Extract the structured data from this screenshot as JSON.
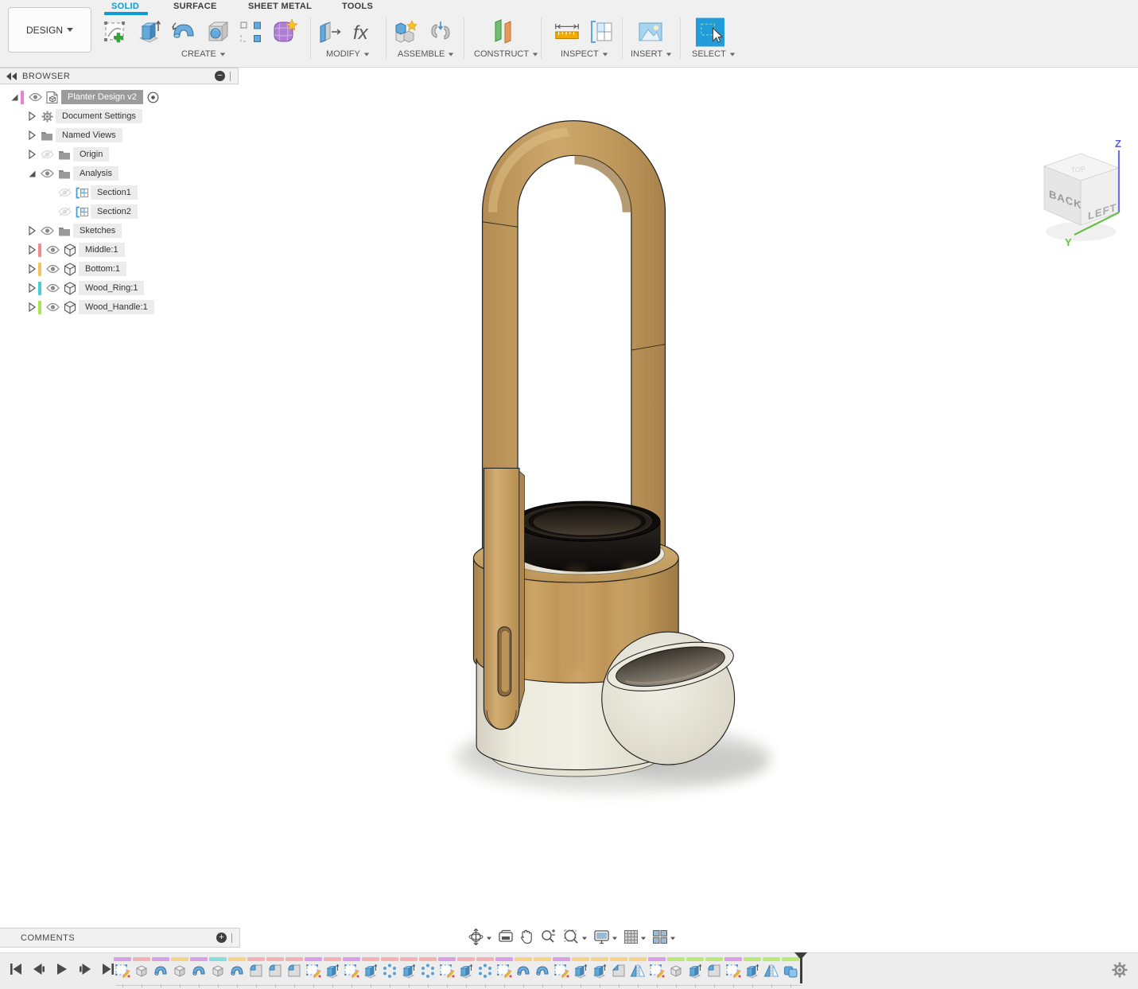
{
  "app": {
    "accent_color": "#0a9bd8",
    "select_blue": "#1f9cd9"
  },
  "design_menu": {
    "label": "DESIGN"
  },
  "tabs": [
    {
      "label": "SOLID",
      "active": true
    },
    {
      "label": "SURFACE",
      "active": false
    },
    {
      "label": "SHEET METAL",
      "active": false
    },
    {
      "label": "TOOLS",
      "active": false
    }
  ],
  "ribbon": {
    "parameters_glyph": "fx",
    "groups": [
      {
        "label": "CREATE",
        "icons": [
          "create-sketch",
          "extrude",
          "revolve",
          "hole",
          "rectangular-pattern",
          "create-form"
        ]
      },
      {
        "label": "MODIFY",
        "icons": [
          "press-pull",
          "change-parameters-fx"
        ]
      },
      {
        "label": "ASSEMBLE",
        "icons": [
          "new-component",
          "joint"
        ]
      },
      {
        "label": "CONSTRUCT",
        "icons": [
          "construction-plane"
        ]
      },
      {
        "label": "INSPECT",
        "icons": [
          "measure",
          "section-analysis"
        ]
      },
      {
        "label": "INSERT",
        "icons": [
          "insert-canvas-image"
        ]
      },
      {
        "label": "SELECT",
        "icons": [
          "select"
        ]
      }
    ]
  },
  "browser": {
    "title": "BROWSER",
    "collapse_icon": "double-left-arrow",
    "header_action_icon": "minus-circle",
    "rows": [
      {
        "label": "Planter Design v2",
        "indent": 0,
        "arrow": "expanded",
        "swatch": "#ee7fd6",
        "eye": "visible",
        "icon": "component-document",
        "selected": true,
        "radio": true
      },
      {
        "label": "Document Settings",
        "indent": 1,
        "arrow": "collapsed",
        "swatch": null,
        "eye": "none",
        "icon": "gear",
        "selected": false,
        "radio": false
      },
      {
        "label": "Named Views",
        "indent": 1,
        "arrow": "collapsed",
        "swatch": null,
        "eye": "none",
        "icon": "folder",
        "selected": false,
        "radio": false
      },
      {
        "label": "Origin",
        "indent": 1,
        "arrow": "collapsed",
        "swatch": null,
        "eye": "hidden",
        "icon": "folder",
        "selected": false,
        "radio": false
      },
      {
        "label": "Analysis",
        "indent": 1,
        "arrow": "expanded",
        "swatch": null,
        "eye": "visible",
        "icon": "folder",
        "selected": false,
        "radio": false
      },
      {
        "label": "Section1",
        "indent": 2,
        "arrow": "none",
        "swatch": null,
        "eye": "hidden",
        "icon": "section",
        "selected": false,
        "radio": false
      },
      {
        "label": "Section2",
        "indent": 2,
        "arrow": "none",
        "swatch": null,
        "eye": "hidden",
        "icon": "section",
        "selected": false,
        "radio": false
      },
      {
        "label": "Sketches",
        "indent": 1,
        "arrow": "collapsed",
        "swatch": null,
        "eye": "visible",
        "icon": "folder",
        "selected": false,
        "radio": false
      },
      {
        "label": "Middle:1",
        "indent": 1,
        "arrow": "collapsed",
        "swatch": "#f28c8c",
        "eye": "visible",
        "icon": "component",
        "selected": false,
        "radio": false
      },
      {
        "label": "Bottom:1",
        "indent": 1,
        "arrow": "collapsed",
        "swatch": "#f7c35b",
        "eye": "visible",
        "icon": "component",
        "selected": false,
        "radio": false
      },
      {
        "label": "Wood_Ring:1",
        "indent": 1,
        "arrow": "collapsed",
        "swatch": "#45d0d6",
        "eye": "visible",
        "icon": "component",
        "selected": false,
        "radio": false
      },
      {
        "label": "Wood_Handle:1",
        "indent": 1,
        "arrow": "collapsed",
        "swatch": "#a9e650",
        "eye": "visible",
        "icon": "component",
        "selected": false,
        "radio": false
      }
    ]
  },
  "viewcube": {
    "faces": [
      "BACK",
      "LEFT",
      "TOP"
    ],
    "axes": [
      "Z",
      "Y"
    ]
  },
  "comments": {
    "title": "COMMENTS",
    "header_action_icon": "plus-circle"
  },
  "navbar": {
    "tools": [
      {
        "name": "orbit",
        "dropdown": true
      },
      {
        "name": "look-at",
        "dropdown": false
      },
      {
        "name": "pan",
        "dropdown": false
      },
      {
        "name": "zoom",
        "dropdown": false
      },
      {
        "name": "fit",
        "dropdown": true
      },
      {
        "name": "display-settings",
        "dropdown": true
      },
      {
        "name": "layout-grid",
        "dropdown": true
      },
      {
        "name": "viewports",
        "dropdown": true
      }
    ]
  },
  "timeline": {
    "playback": [
      "skip-to-start",
      "step-back",
      "play",
      "step-forward",
      "skip-to-end"
    ],
    "settings_icon": "gear",
    "items": [
      {
        "type": "sketch",
        "color": "#d9a0e8"
      },
      {
        "type": "box",
        "color": "#f5b3b3"
      },
      {
        "type": "revolve",
        "color": "#d9a0e8"
      },
      {
        "type": "box",
        "color": "#f8d385"
      },
      {
        "type": "revolve",
        "color": "#d9a0e8"
      },
      {
        "type": "box",
        "color": "#85dede"
      },
      {
        "type": "revolve",
        "color": "#f8d385"
      },
      {
        "type": "fillet",
        "color": "#f5b3b3"
      },
      {
        "type": "fillet",
        "color": "#f5b3b3"
      },
      {
        "type": "fillet",
        "color": "#f5b3b3"
      },
      {
        "type": "sketch",
        "color": "#d9a0e8"
      },
      {
        "type": "extrude",
        "color": "#f5b3b3"
      },
      {
        "type": "sketch",
        "color": "#d9a0e8"
      },
      {
        "type": "extrude",
        "color": "#f5b3b3"
      },
      {
        "type": "pattern",
        "color": "#f5b3b3"
      },
      {
        "type": "extrude",
        "color": "#f5b3b3"
      },
      {
        "type": "pattern",
        "color": "#f5b3b3"
      },
      {
        "type": "sketch",
        "color": "#d9a0e8"
      },
      {
        "type": "extrude",
        "color": "#f5b3b3"
      },
      {
        "type": "pattern",
        "color": "#f5b3b3"
      },
      {
        "type": "sketch",
        "color": "#d9a0e8"
      },
      {
        "type": "revolve",
        "color": "#f8d385"
      },
      {
        "type": "revolve",
        "color": "#f8d385"
      },
      {
        "type": "sketch",
        "color": "#d9a0e8"
      },
      {
        "type": "extrude",
        "color": "#f8d385"
      },
      {
        "type": "extrude",
        "color": "#f8d385"
      },
      {
        "type": "chamfer",
        "color": "#f8d385"
      },
      {
        "type": "mirror",
        "color": "#f8d385"
      },
      {
        "type": "sketch",
        "color": "#d9a0e8"
      },
      {
        "type": "box",
        "color": "#bce878"
      },
      {
        "type": "extrude",
        "color": "#bce878"
      },
      {
        "type": "fillet",
        "color": "#bce878"
      },
      {
        "type": "sketch",
        "color": "#d9a0e8"
      },
      {
        "type": "extrude",
        "color": "#bce878"
      },
      {
        "type": "mirror",
        "color": "#bce878"
      },
      {
        "type": "combine",
        "color": "#bce878"
      }
    ]
  }
}
